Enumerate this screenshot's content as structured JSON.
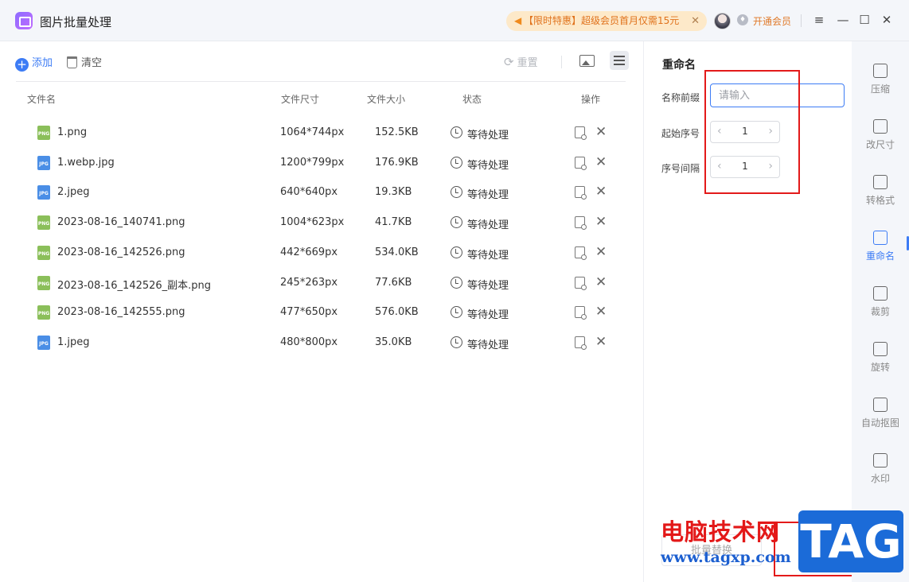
{
  "app": {
    "title": "图片批量处理"
  },
  "promo": {
    "text": "【限时特惠】超级会员首月仅需15元",
    "speaker_icon": "speaker-icon",
    "close_icon": "close-icon"
  },
  "vip": {
    "label": "开通会员"
  },
  "window_controls": {
    "menu": "≡",
    "minimize": "—",
    "maximize": "☐",
    "close": "✕"
  },
  "toolbar": {
    "add_label": "添加",
    "clear_label": "清空",
    "reset_label": "重置"
  },
  "table": {
    "headers": {
      "name": "文件名",
      "dims": "文件尺寸",
      "size": "文件大小",
      "status": "状态",
      "actions": "操作"
    },
    "rows": [
      {
        "icon": "PNG",
        "type": "png",
        "name": "1.png",
        "dims": "1064*744px",
        "size": "152.5KB",
        "status": "等待处理"
      },
      {
        "icon": "JPG",
        "type": "jpg",
        "name": "1.webp.jpg",
        "dims": "1200*799px",
        "size": "176.9KB",
        "status": "等待处理"
      },
      {
        "icon": "JPG",
        "type": "jpg",
        "name": "2.jpeg",
        "dims": "640*640px",
        "size": "19.3KB",
        "status": "等待处理"
      },
      {
        "icon": "PNG",
        "type": "png",
        "name": "2023-08-16_140741.png",
        "dims": "1004*623px",
        "size": "41.7KB",
        "status": "等待处理"
      },
      {
        "icon": "PNG",
        "type": "png",
        "name": "2023-08-16_142526.png",
        "dims": "442*669px",
        "size": "534.0KB",
        "status": "等待处理"
      },
      {
        "icon": "PNG",
        "type": "png",
        "name": "2023-08-16_142526_副本.png",
        "dims": "245*263px",
        "size": "77.6KB",
        "status": "等待处理"
      },
      {
        "icon": "PNG",
        "type": "png",
        "name": "2023-08-16_142555.png",
        "dims": "477*650px",
        "size": "576.0KB",
        "status": "等待处理"
      },
      {
        "icon": "JPG",
        "type": "jpg",
        "name": "1.jpeg",
        "dims": "480*800px",
        "size": "35.0KB",
        "status": "等待处理"
      }
    ]
  },
  "rename": {
    "title": "重命名",
    "prefix_label": "名称前缀",
    "prefix_placeholder": "请输入",
    "start_label": "起始序号",
    "start_value": "1",
    "step_label": "序号间隔",
    "step_value": "1",
    "dec": "‹",
    "inc": "›"
  },
  "bottom": {
    "batch_replace": "批量替换"
  },
  "sidenav": [
    {
      "label": "压缩",
      "icon": "compress-icon"
    },
    {
      "label": "改尺寸",
      "icon": "resize-icon"
    },
    {
      "label": "转格式",
      "icon": "convert-icon"
    },
    {
      "label": "重命名",
      "icon": "rename-icon",
      "active": true
    },
    {
      "label": "裁剪",
      "icon": "crop-icon"
    },
    {
      "label": "旋转",
      "icon": "rotate-icon"
    },
    {
      "label": "自动抠图",
      "icon": "cutout-icon"
    },
    {
      "label": "水印",
      "icon": "watermark-icon"
    }
  ],
  "watermark": {
    "cn": "电脑技术网",
    "url": "www.tagxp.com",
    "tag": "TAG"
  },
  "colors": {
    "accent": "#3d7cf5",
    "annotation_red": "#e31a1a",
    "promo_bg": "#fde9c9"
  }
}
